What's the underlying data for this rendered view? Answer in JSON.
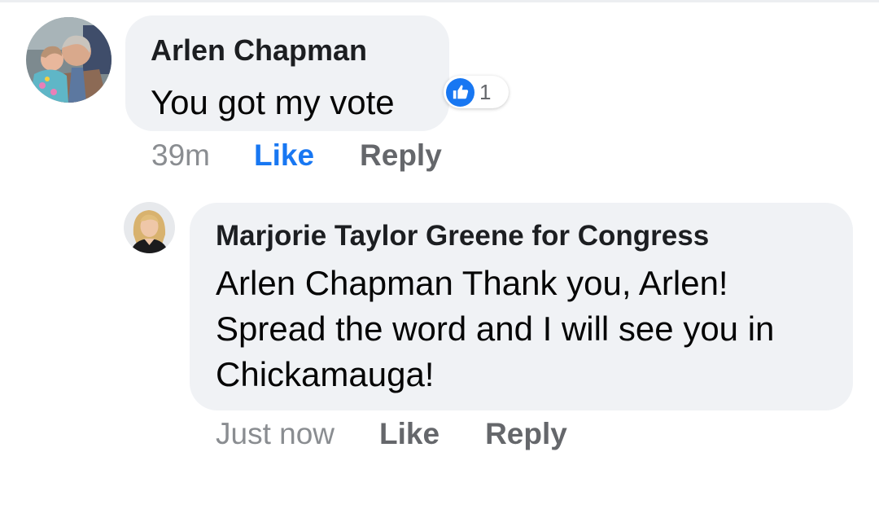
{
  "comments": [
    {
      "author": "Arlen Chapman",
      "text": "You got my vote",
      "reaction": {
        "icon": "thumbs-up-icon",
        "count": "1",
        "color": "#1877f2"
      },
      "timestamp": "39m",
      "like_label": "Like",
      "like_active": true,
      "reply_label": "Reply"
    },
    {
      "author": "Marjorie Taylor Greene for Congress",
      "text": "Arlen Chapman Thank you, Arlen! Spread the word and I will see you in Chickamauga!",
      "timestamp": "Just now",
      "like_label": "Like",
      "like_active": false,
      "reply_label": "Reply"
    }
  ],
  "colors": {
    "bubble": "#f0f2f5",
    "like_active": "#1877f2",
    "secondary_text": "#65676b"
  }
}
